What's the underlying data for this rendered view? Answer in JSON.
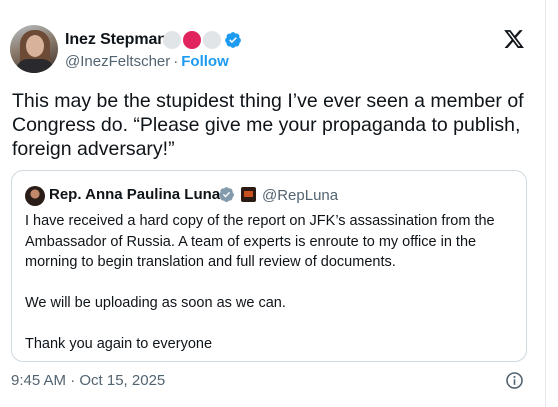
{
  "author": {
    "name": "Inez Stepman",
    "handle": "@InezFeltscher",
    "separator": "·",
    "follow_label": "Follow"
  },
  "colors": {
    "accent": "#1d9bf0",
    "text": "#0f1419",
    "muted": "#536471",
    "border": "#cfd9de"
  },
  "tweet": {
    "text": "This may be the stupidest thing I’ve ever seen a member of Congress do. “Please give me your propaganda to publish, foreign adversary!”"
  },
  "quote": {
    "name": "Rep. Anna Paulina Luna",
    "handle": "@RepLuna",
    "paragraphs": [
      "I have received a hard copy of the report on JFK’s assassination from the Ambassador of Russia. A team of experts is enroute to my office in the morning to begin translation and full review of documents.",
      "We will be uploading as soon as we can.",
      "Thank you again to everyone"
    ]
  },
  "footer": {
    "timestamp": "9:45 AM · Oct 15, 2025"
  }
}
